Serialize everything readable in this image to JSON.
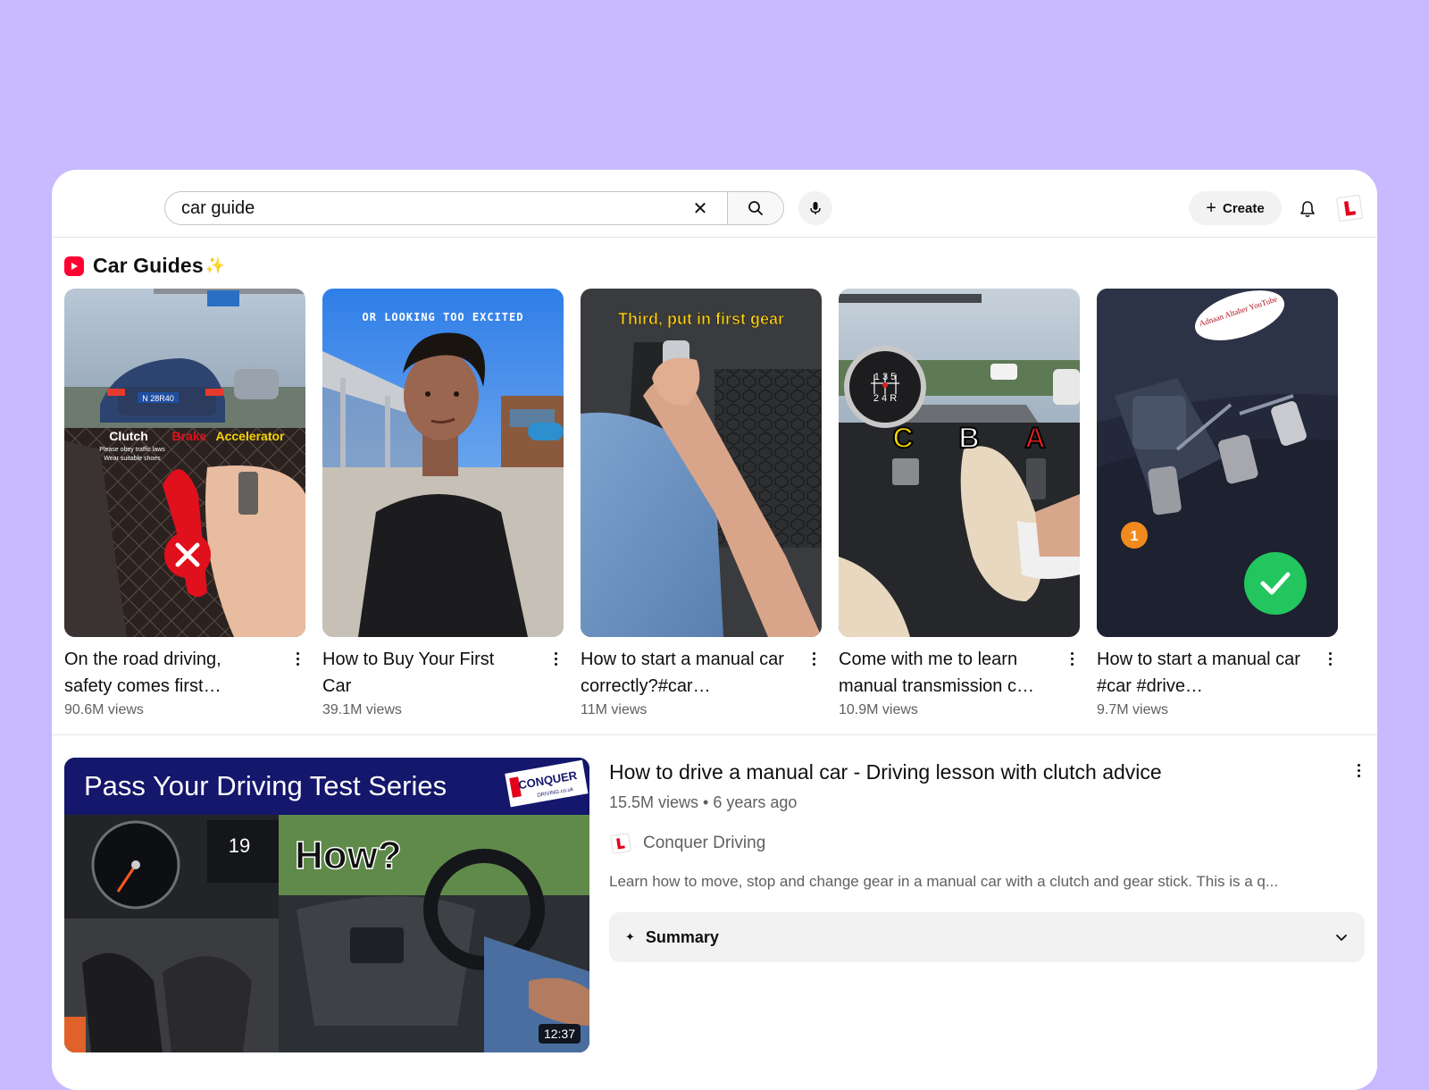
{
  "search": {
    "value": "car guide",
    "clear_icon": "close-icon",
    "search_icon": "search-icon",
    "mic_icon": "microphone-icon"
  },
  "header": {
    "create_label": "Create",
    "bell_icon": "notifications-icon",
    "avatar_icon": "channel-avatar-l-plate"
  },
  "shelf": {
    "title": "Car Guides",
    "title_emoji": "✨",
    "items": [
      {
        "title": "On the road driving, safety comes first…",
        "views": "90.6M views",
        "overlay": {
          "plate": "N 28R40",
          "clutch": "Clutch",
          "brake": "Brake",
          "accelerator": "Accelerator",
          "note1": "Please obey traffic laws",
          "note2": "Wear suitable shoes"
        }
      },
      {
        "title": "How to Buy Your First Car",
        "views": "39.1M views",
        "overlay": {
          "caption": "OR LOOKING TOO EXCITED"
        }
      },
      {
        "title": "How to start a manual car correctly?#car…",
        "views": "11M views",
        "overlay": {
          "caption": "Third, put in first gear"
        }
      },
      {
        "title": "Come with me to learn manual transmission c…",
        "views": "10.9M views",
        "overlay": {
          "c": "C",
          "b": "B",
          "a": "A"
        }
      },
      {
        "title": "How to start a manual car #car #drive…",
        "views": "9.7M views",
        "overlay": {
          "badge": "1",
          "sticker": "Adnaan Altaher YouTube"
        }
      }
    ]
  },
  "video": {
    "title": "How to drive a manual car - Driving lesson with clutch advice",
    "meta": "15.5M views • 6 years ago",
    "channel": "Conquer Driving",
    "description": "Learn how to move, stop and change gear in a manual car with a clutch and gear stick. This is a q...",
    "duration": "12:37",
    "summary_label": "Summary",
    "thumb": {
      "banner": "Pass Your Driving Test Series",
      "brand": "CONQUER",
      "brand_sub": "DRIVING.co.uk",
      "how": "How?",
      "speed": "19"
    }
  },
  "colors": {
    "background": "#c9baff",
    "shorts_red": "#ff0033",
    "secondary_text": "#606060"
  }
}
